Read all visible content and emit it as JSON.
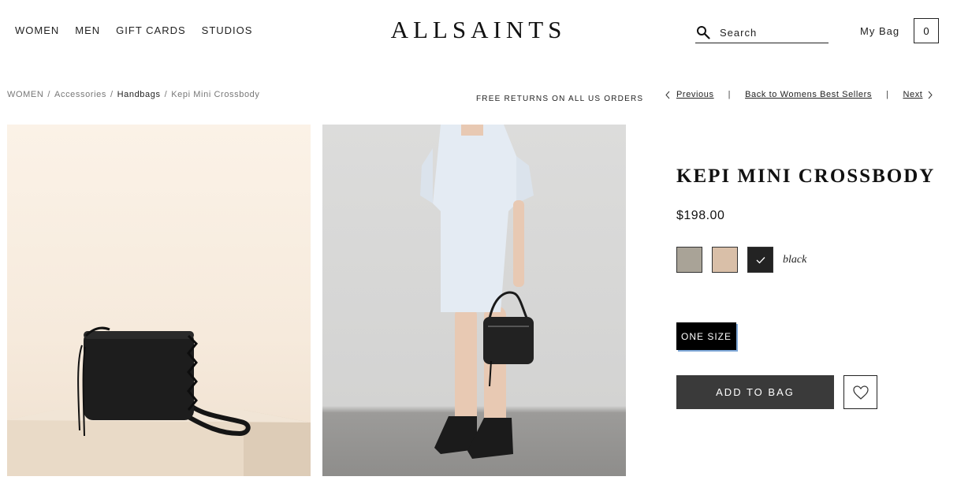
{
  "header": {
    "nav": [
      "WOMEN",
      "MEN",
      "GIFT CARDS",
      "STUDIOS"
    ],
    "logo": "ALLSAINTS",
    "search_placeholder": "Search",
    "my_bag_label": "My Bag",
    "bag_count": "0"
  },
  "breadcrumb": {
    "items": [
      "WOMEN",
      "Accessories",
      "Handbags",
      "Kepi Mini Crossbody"
    ],
    "separator": "/"
  },
  "promo": "FREE RETURNS ON ALL US ORDERS",
  "pager": {
    "previous": "Previous",
    "back": "Back to Womens Best Sellers",
    "next": "Next",
    "separator": "|"
  },
  "product": {
    "title": "KEPI MINI CROSSBODY",
    "price": "$198.00",
    "swatches": [
      {
        "color": "#a9a397",
        "selected": false
      },
      {
        "color": "#d9bfa8",
        "selected": false
      },
      {
        "color": "#232323",
        "selected": true
      }
    ],
    "selected_color_name": "black",
    "size_label": "ONE SIZE",
    "add_to_bag_label": "ADD TO BAG"
  }
}
